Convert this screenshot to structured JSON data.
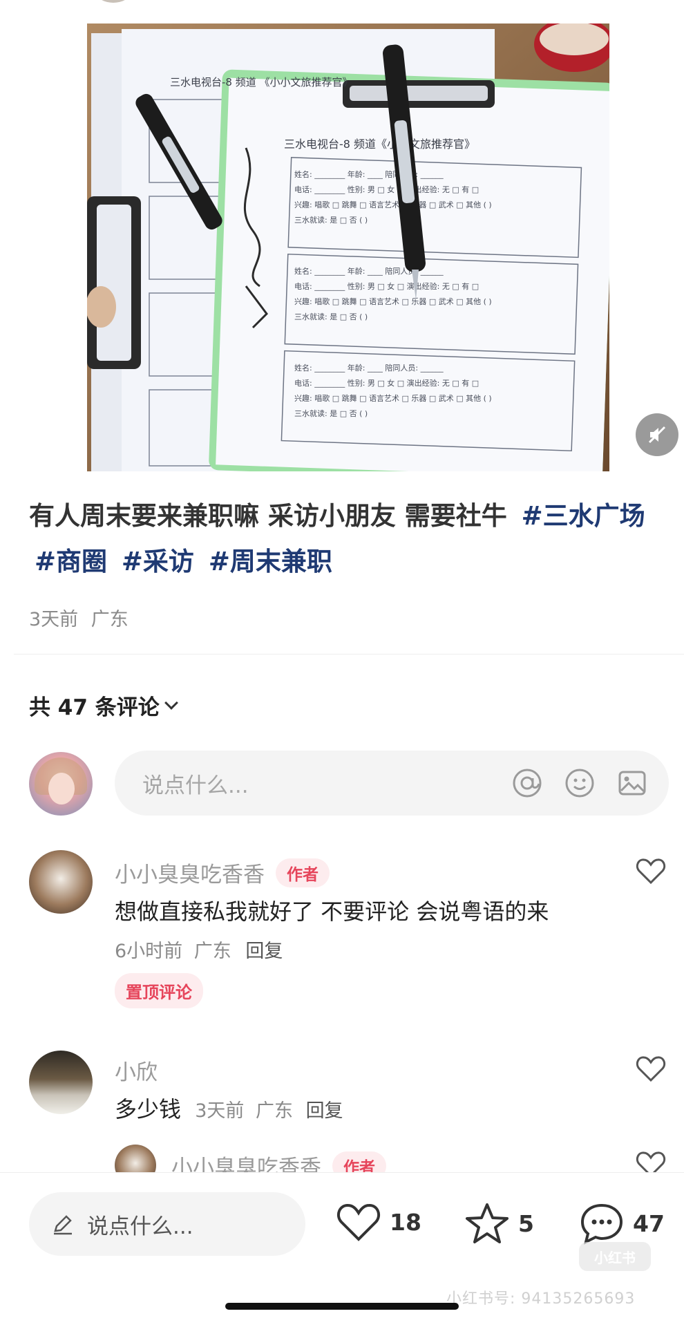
{
  "post": {
    "text": "有人周末要来兼职嘛 采访小朋友 需要社牛",
    "tags": [
      "#三水广场",
      "#商圈",
      "#采访",
      "#周末兼职"
    ],
    "time": "3天前",
    "location": "广东"
  },
  "photo_form": {
    "title_a": "三水电视台-8 频道",
    "title_b": "《小小文旅推荐官》",
    "field_name": "姓名:",
    "field_age": "年龄:",
    "field_companion": "陪同人员:",
    "field_phone": "电话:",
    "field_gender": "性别: 男 □ 女 □",
    "field_hobby": "兴趣: 唱歌 □ 跳舞 □ 语言艺术 □ 乐器 □ 武术 □ 其他 ( )",
    "field_experience": "演出经验: 无 □ 有 □",
    "field_sanshui": "三水就读: 是 □ 否 ( )"
  },
  "comments_header": {
    "count_label": "共 47 条评论"
  },
  "comment_input": {
    "placeholder": "说点什么..."
  },
  "comments": [
    {
      "name": "小小臭臭吃香香",
      "badge": "作者",
      "text": "想做直接私我就好了 不要评论 会说粤语的来",
      "time": "6小时前",
      "location": "广东",
      "reply": "回复",
      "pinned": "置顶评论"
    },
    {
      "name": "小欣",
      "text": "多少钱",
      "time": "3天前",
      "location": "广东",
      "reply": "回复"
    },
    {
      "name": "小小臭臭吃香香",
      "badge": "作者"
    }
  ],
  "bottom_bar": {
    "placeholder": "说点什么...",
    "likes": "18",
    "stars": "5",
    "comments": "47"
  },
  "watermark": {
    "text": "小红书号: 9413526569​3",
    "logo": "小红书"
  },
  "colors": {
    "tag": "#1f3a73",
    "author_badge": "#e6455b",
    "author_badge_bg": "#fdecee"
  }
}
